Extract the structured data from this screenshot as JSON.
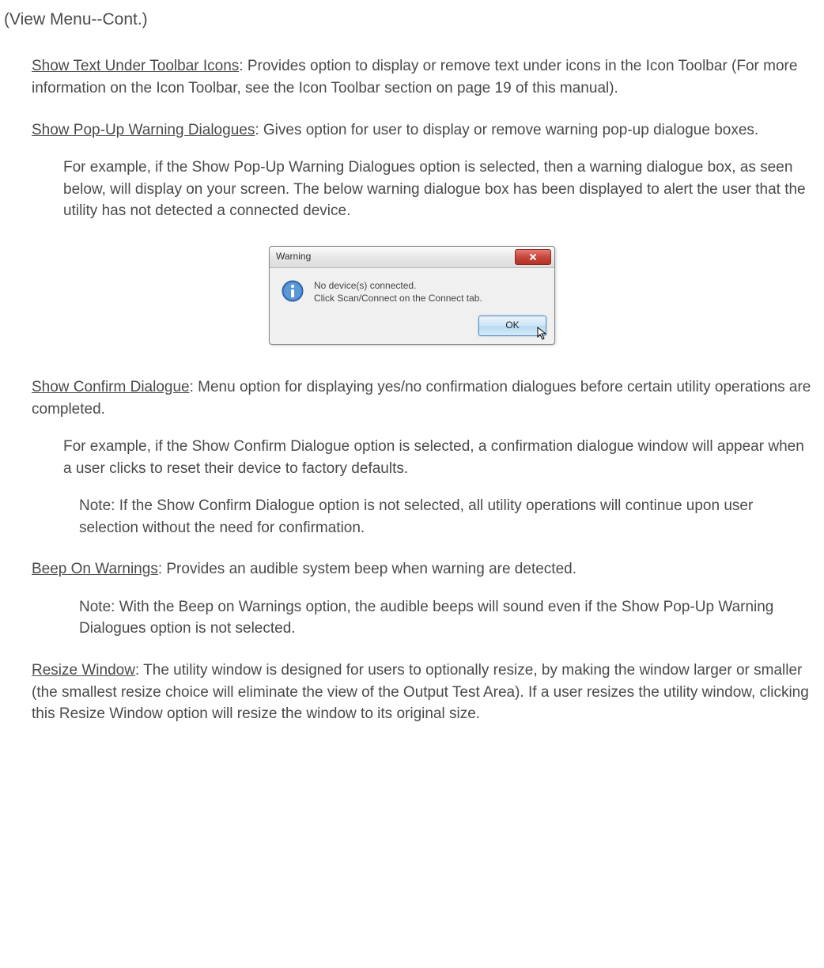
{
  "page_title": "(View Menu--Cont.)",
  "sections": {
    "show_text": {
      "term": "Show Text Under Toolbar Icons",
      "body": ": Provides option to display or remove text under icons in the Icon Toolbar (For more information on the Icon Toolbar, see the Icon Toolbar section on page 19 of this manual)."
    },
    "show_popup": {
      "term": "Show Pop-Up Warning Dialogues",
      "body": ": Gives option for user to display or remove warning pop-up dialogue boxes.",
      "example": "For example, if the Show Pop-Up Warning Dialogues option is selected, then a warning dialogue box, as seen below, will display on your screen. The below warning dialogue box has been displayed to alert the user that the utility has not detected a connected device."
    },
    "dialog": {
      "title": "Warning",
      "line1": "No device(s) connected.",
      "line2": "Click Scan/Connect on the Connect tab.",
      "ok": "OK"
    },
    "show_confirm": {
      "term": "Show Confirm Dialogue",
      "body": ": Menu option for displaying yes/no confirmation dialogues before certain utility operations are completed.",
      "example": "For example, if the Show Confirm Dialogue option is selected, a confirmation dialogue window will appear when a user clicks to reset their device to factory defaults.",
      "note": "Note: If the Show Confirm Dialogue option is not selected, all utility operations will continue upon user selection without the need for confirmation."
    },
    "beep": {
      "term": "Beep On Warnings",
      "body": ": Provides an audible system beep when warning are detected.",
      "note": "Note: With the Beep on Warnings option, the audible beeps will sound even if the Show Pop-Up Warning Dialogues option is not selected."
    },
    "resize": {
      "term": "Resize Window",
      "body": ": The utility window is designed for users to optionally resize, by making the window larger or smaller (the smallest resize choice will eliminate the view of the Output Test Area). If a user resizes the utility window, clicking this Resize Window option will resize the window to its original size."
    }
  }
}
